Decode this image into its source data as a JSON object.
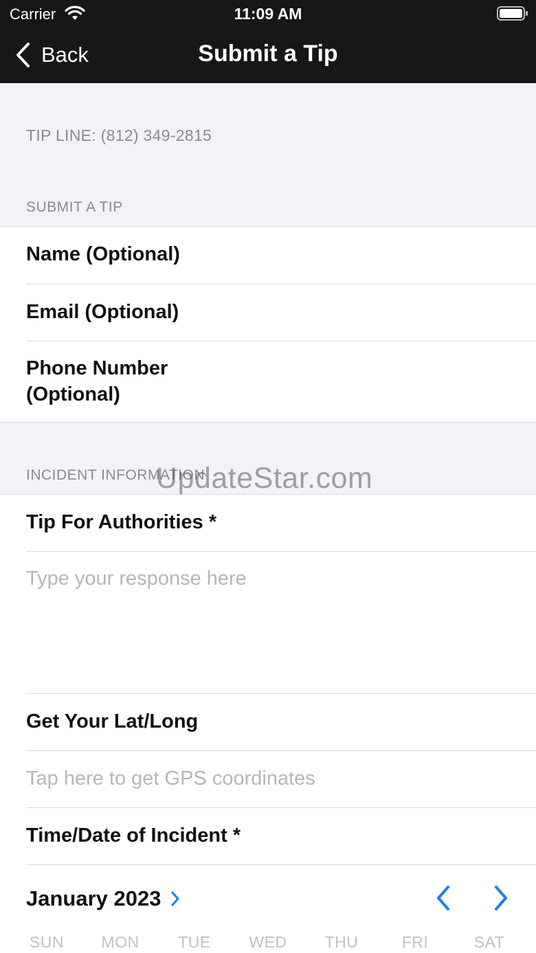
{
  "status_bar": {
    "carrier": "Carrier",
    "time": "11:09 AM"
  },
  "nav": {
    "back_label": "Back",
    "title": "Submit a Tip"
  },
  "tip_line": "TIP LINE: (812) 349-2815",
  "section_submit": {
    "header": "SUBMIT A TIP",
    "fields": {
      "name": "Name (Optional)",
      "email": "Email (Optional)",
      "phone_line1": "Phone Number",
      "phone_line2": "(Optional)"
    }
  },
  "section_incident": {
    "header": "INCIDENT INFORMATION",
    "tip_label": "Tip For Authorities *",
    "tip_placeholder": "Type your response here",
    "latlong_label": "Get Your Lat/Long",
    "gps_placeholder": "Tap here to get GPS coordinates",
    "datetime_label": "Time/Date of Incident *"
  },
  "calendar": {
    "month": "January 2023",
    "weekdays": [
      "SUN",
      "MON",
      "TUE",
      "WED",
      "THU",
      "FRI",
      "SAT"
    ],
    "accent": "#1a7ef0"
  },
  "watermark": "UpdateStar.com"
}
